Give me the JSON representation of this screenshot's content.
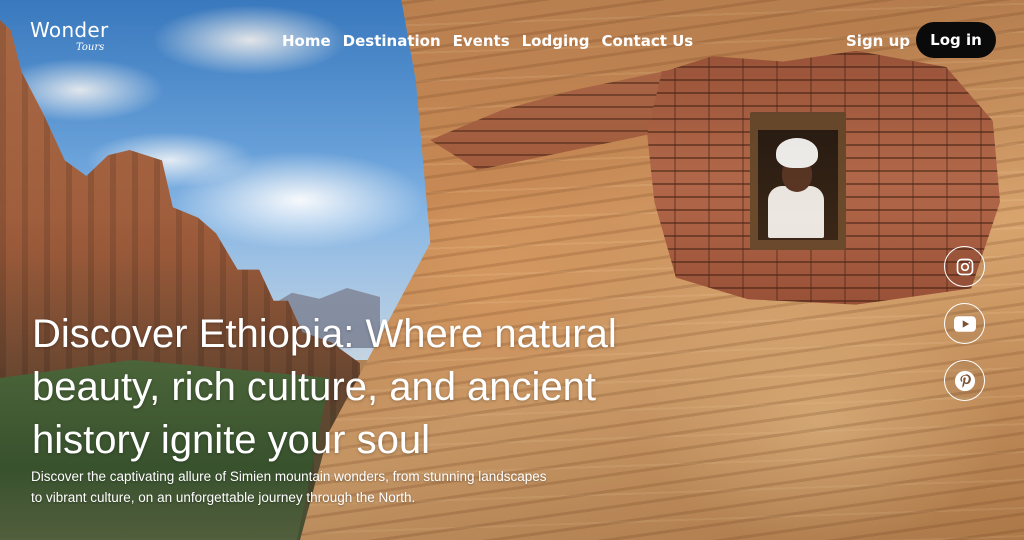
{
  "brand": {
    "name": "Wonder",
    "tagline": "Tours"
  },
  "nav": {
    "items": [
      "Home",
      "Destination",
      "Events",
      "Lodging",
      "Contact Us"
    ]
  },
  "auth": {
    "signup_label": "Sign up",
    "login_label": "Log in"
  },
  "hero": {
    "title": "Discover Ethiopia: Where natural beauty, rich culture, and ancient history ignite your soul",
    "subtitle": "Discover the captivating allure of Simien mountain wonders, from stunning landscapes to vibrant culture, on an unforgettable journey through the North."
  },
  "social": [
    {
      "icon": "instagram-icon"
    },
    {
      "icon": "youtube-icon"
    },
    {
      "icon": "pinterest-icon"
    }
  ],
  "colors": {
    "text": "#ffffff",
    "login_bg": "#0a0a0a"
  }
}
